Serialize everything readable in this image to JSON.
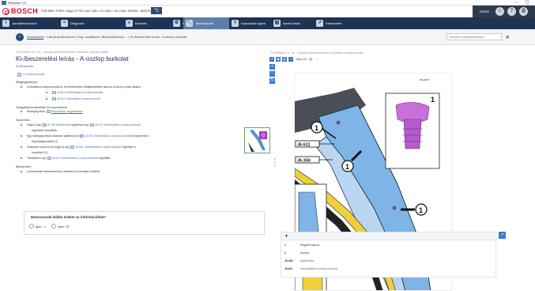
{
  "window": {
    "title": "ESItronic 2.0",
    "minimize": "–",
    "maximize": "▢"
  },
  "header": {
    "brand": "BOSCH",
    "vehicle": "FOR 9962 / FORD / Kuga 2.0 TDCi 4x4 / 2MU / 2.0 / 88.0 / 121.0 kW / 06/2016 - 05/2019 / T7MA",
    "back": "⮌",
    "user": "DEMO",
    "icons": [
      "user-icon",
      "help-icon",
      "print-icon"
    ]
  },
  "nav": [
    {
      "label": "Járműinformációk",
      "icon": "i"
    },
    {
      "label": "Diagnózis",
      "icon": "≈"
    },
    {
      "label": "Keresés",
      "icon": "⌕"
    },
    {
      "label": "Karbantartás",
      "icon": "⚙"
    },
    {
      "label": "Javítóknyvek",
      "icon": "🔧",
      "active": true
    },
    {
      "label": "Kapcsolási rajzok",
      "icon": "ϟ"
    },
    {
      "label": "Ismert hibák",
      "icon": "▤"
    },
    {
      "label": "Felszerelés",
      "icon": "↗"
    }
  ],
  "breadcrumb": {
    "home": "‹",
    "link": "Karosszéria",
    "rest": " > Lármá jelzőrendszer, Dug. csatlakozó, Biztosítékdoboz... > Ki-/beszerelési leírás - A-oszlop burkolat",
    "search_placeholder": "Keresés a dokumentumban",
    "search_btn": "⌕"
  },
  "doc": {
    "copyright": "© Ford Motor Co., Ltd. -- provided under license from Ford Motor Company Limited.",
    "title": "Ki-/beszerelési leírás - A-oszlop burkolat",
    "subtitle": "Ki-/beszerelés",
    "tag": "A-oszlop burkolat",
    "section1": "Megjegyzés(ek):",
    "note1": "A következő komponensek ki- és beszerelése fül/ajtókeretben azonos a bal és a jobb oldalon.",
    "note1_refs": [
      "J6.611 Vezetőoldali A-oszlop burkolat",
      "J6.612 Utasoldali A-oszlop burkolat"
    ],
    "section2": "Vizsgálóberendezések és szerszámok:",
    "tools_label": "Műanyag ékek:",
    "tools_link": "Információk megtekintése",
    "section3": "Kiszerelés:",
    "steps": [
      {
        "pre": "Oldja ki a(z)",
        "ref1": "J6.350 Ajtótömítés",
        "mid": "rögzítéseit a(z)",
        "ref2": "J6.611 Vezetőoldali A-oszlop burkolat",
        "post": ""
      },
      {
        "pre": "rögzítései környékén.",
        "ref1": "",
        "mid": "",
        "ref2": "",
        "post": ""
      },
      {
        "pre": "Egy műanyag ékkel óvatosan pattintsa ki a",
        "ref1": "J6.611 Vezetőoldali A-oszlop burkolat",
        "mid": "komponenst a",
        "ref2": "",
        "post": ""
      },
      {
        "pre": "rögzítőkapcsokból (1).",
        "ref1": "",
        "mid": "",
        "ref2": "",
        "post": ""
      },
      {
        "pre": "Óvatosan húzza ki és vegye ki a(z)",
        "ref1": "J6.611 Vezetőoldali A-oszlop burkolat",
        "mid": "rögzítőjét a",
        "ref2": "",
        "post": ""
      },
      {
        "pre": "vezetőből (2).",
        "ref1": "",
        "mid": "",
        "ref2": "",
        "post": ""
      },
      {
        "pre": "Távolítsa el a(z)",
        "ref1": "J6.611 Vezetőoldali A-oszlop burkolat",
        "mid": "rögzítőjét.",
        "ref2": "",
        "post": ""
      }
    ],
    "section4": "Beszerelés:",
    "install": "A beszerelés értelemszerűen ellenkező sorrendben történik."
  },
  "feedback": {
    "question": "Hasznosnak találta ezeket az információkat?",
    "yes": "Igen",
    "no": "Nem"
  },
  "viewer": {
    "copyright": "© Ford Motor Co., Ltd. -- provided under license from Ford Motor Company Limited.",
    "page": "Ábra 1/1",
    "image_id": "BD10847",
    "callouts": [
      "1",
      "1",
      "1",
      "1"
    ],
    "labels": [
      "J6.611",
      "J6.350"
    ]
  },
  "legend": {
    "toggle": "▼",
    "expand": "↗",
    "rows": [
      {
        "k": "1",
        "v": "Rögzítő-kapocs."
      },
      {
        "k": "2",
        "v": "Vezető."
      },
      {
        "k": "J6.350",
        "v": "Ajtótömítés."
      },
      {
        "k": "J6.611",
        "v": "Vezetőoldali A-oszlop burkolat."
      }
    ]
  },
  "colors": {
    "navy": "#1f3352",
    "accent": "#5f7ea8",
    "bosch_red": "#c8102e",
    "link": "#4a6fa5"
  }
}
